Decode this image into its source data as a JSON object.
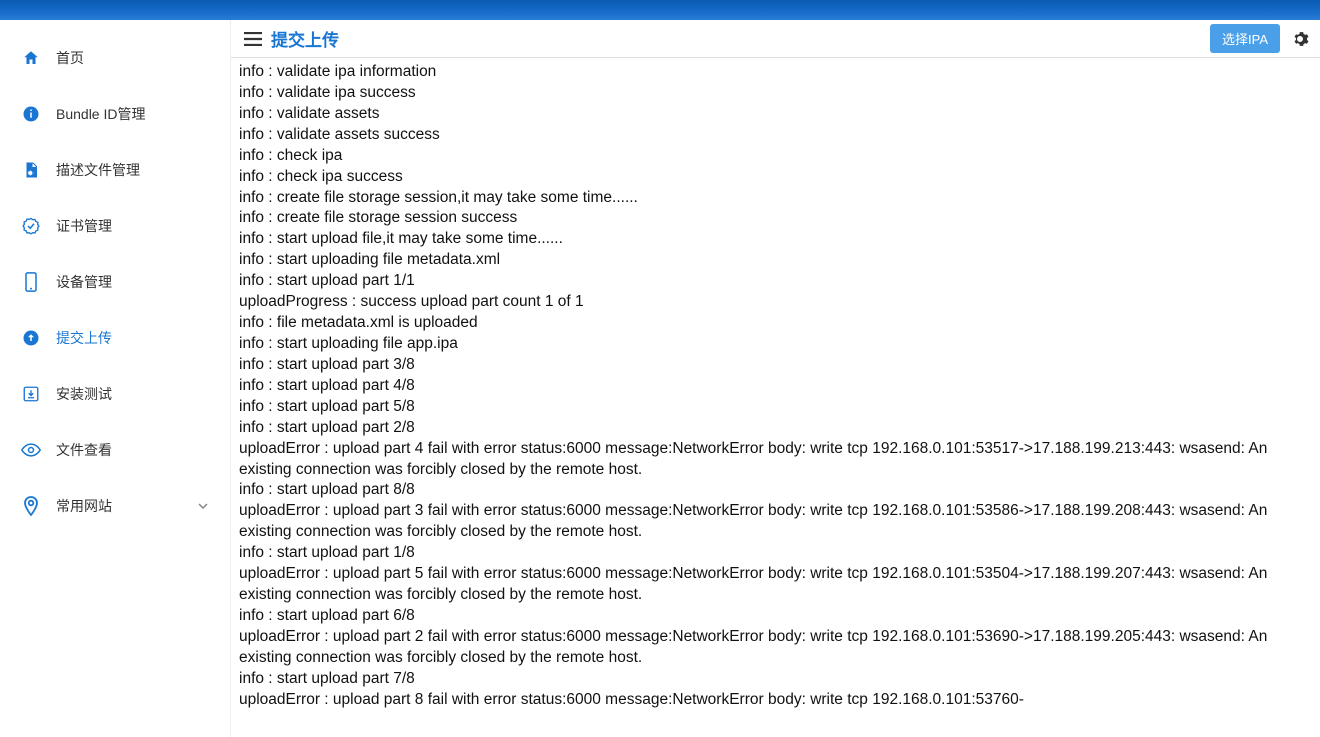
{
  "header": {
    "title": "提交上传",
    "select_button": "选择IPA"
  },
  "sidebar": {
    "items": [
      {
        "label": "首页",
        "icon": "home",
        "active": false
      },
      {
        "label": "Bundle ID管理",
        "icon": "info-circle",
        "active": false
      },
      {
        "label": "描述文件管理",
        "icon": "file-settings",
        "active": false
      },
      {
        "label": "证书管理",
        "icon": "badge-check",
        "active": false
      },
      {
        "label": "设备管理",
        "icon": "device-phone",
        "active": false
      },
      {
        "label": "提交上传",
        "icon": "upload-circle",
        "active": true
      },
      {
        "label": "安装测试",
        "icon": "install-test",
        "active": false
      },
      {
        "label": "文件查看",
        "icon": "eye",
        "active": false
      },
      {
        "label": "常用网站",
        "icon": "location",
        "active": false,
        "expandable": true
      }
    ]
  },
  "logs": [
    "info : validate ipa information",
    "info : validate ipa success",
    "info : validate assets",
    "info : validate assets success",
    "info : check ipa",
    "info : check ipa success",
    "info : create file storage session,it may take some time......",
    "info : create file storage session success",
    "info : start upload file,it may take some time......",
    "info : start uploading file metadata.xml",
    "info : start upload part 1/1",
    "uploadProgress : success upload part count 1 of 1",
    "info : file metadata.xml is uploaded",
    "info : start uploading file app.ipa",
    "info : start upload part 3/8",
    "info : start upload part 4/8",
    "info : start upload part 5/8",
    "info : start upload part 2/8",
    "uploadError : upload part 4 fail with error status:6000 message:NetworkError body: write tcp 192.168.0.101:53517->17.188.199.213:443: wsasend: An existing connection was forcibly closed by the remote host.",
    "info : start upload part 8/8",
    "uploadError : upload part 3 fail with error status:6000 message:NetworkError body: write tcp 192.168.0.101:53586->17.188.199.208:443: wsasend: An existing connection was forcibly closed by the remote host.",
    "info : start upload part 1/8",
    "uploadError : upload part 5 fail with error status:6000 message:NetworkError body: write tcp 192.168.0.101:53504->17.188.199.207:443: wsasend: An existing connection was forcibly closed by the remote host.",
    "info : start upload part 6/8",
    "uploadError : upload part 2 fail with error status:6000 message:NetworkError body: write tcp 192.168.0.101:53690->17.188.199.205:443: wsasend: An existing connection was forcibly closed by the remote host.",
    "info : start upload part 7/8",
    "uploadError : upload part 8 fail with error status:6000 message:NetworkError body: write tcp 192.168.0.101:53760-"
  ],
  "icons": {
    "home": "home-icon",
    "info-circle": "info-circle-icon",
    "file-settings": "file-settings-icon",
    "badge-check": "badge-check-icon",
    "device-phone": "device-phone-icon",
    "upload-circle": "upload-circle-icon",
    "install-test": "install-test-icon",
    "eye": "eye-icon",
    "location": "location-icon"
  }
}
